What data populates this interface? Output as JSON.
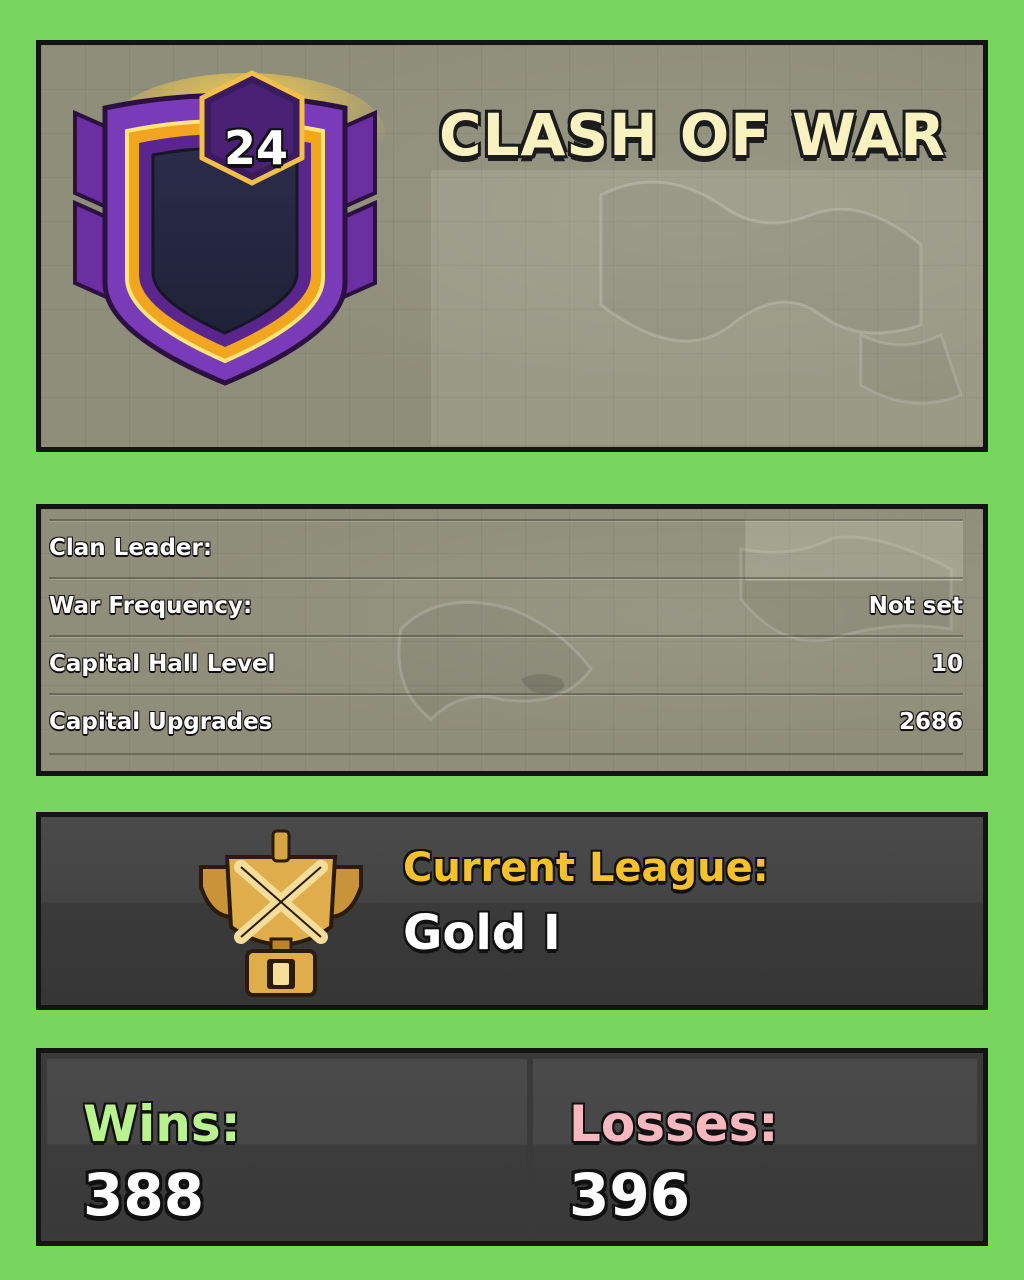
{
  "clan": {
    "level": "24",
    "name": "CLASH OF WAR"
  },
  "info": {
    "rows": [
      {
        "label": "Clan Leader:",
        "value": ""
      },
      {
        "label": "War Frequency:",
        "value": "Not set"
      },
      {
        "label": "Capital Hall Level",
        "value": "10"
      },
      {
        "label": "Capital Upgrades",
        "value": "2686"
      }
    ]
  },
  "league": {
    "label": "Current League:",
    "value": "Gold I",
    "trophy_rank": "I"
  },
  "record": {
    "wins_label": "Wins:",
    "wins_value": "388",
    "losses_label": "Losses:",
    "losses_value": "396"
  },
  "colors": {
    "background": "#76d65e",
    "wins": "#b9f28e",
    "losses": "#f7b7bf",
    "league_label": "#f5c12c",
    "clan_name": "#f7f2bf"
  }
}
